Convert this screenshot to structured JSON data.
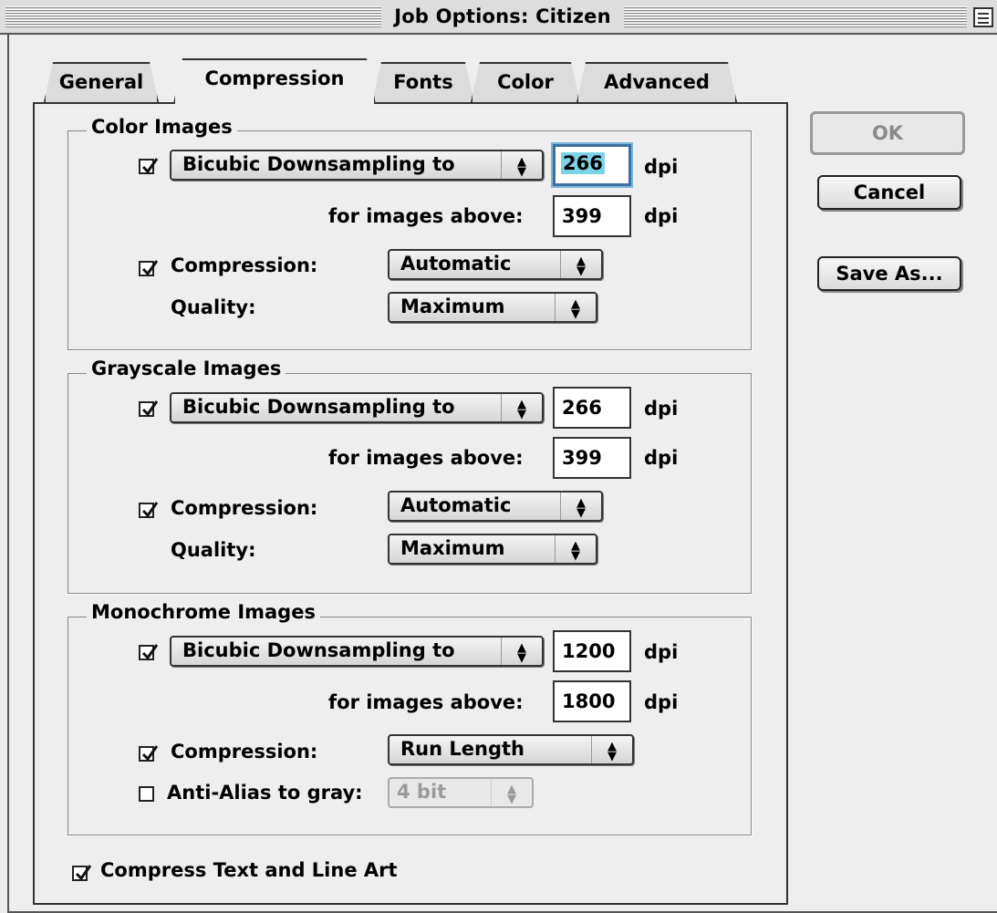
{
  "window": {
    "title": "Job Options: Citizen"
  },
  "tabs": [
    {
      "label": "General"
    },
    {
      "label": "Compression"
    },
    {
      "label": "Fonts"
    },
    {
      "label": "Color"
    },
    {
      "label": "Advanced"
    }
  ],
  "active_tab": "Compression",
  "buttons": {
    "ok": "OK",
    "cancel": "Cancel",
    "save_as": "Save As..."
  },
  "common": {
    "dpi_unit": "dpi",
    "above_label": "for images above:",
    "compression_label": "Compression:",
    "quality_label": "Quality:"
  },
  "color_images": {
    "title": "Color Images",
    "downsample_checked": true,
    "downsample_method": "Bicubic Downsampling to",
    "resolution": "266",
    "above": "399",
    "compression_checked": true,
    "compression": "Automatic",
    "quality": "Maximum"
  },
  "grayscale_images": {
    "title": "Grayscale Images",
    "downsample_checked": true,
    "downsample_method": "Bicubic Downsampling to",
    "resolution": "266",
    "above": "399",
    "compression_checked": true,
    "compression": "Automatic",
    "quality": "Maximum"
  },
  "monochrome_images": {
    "title": "Monochrome Images",
    "downsample_checked": true,
    "downsample_method": "Bicubic Downsampling to",
    "resolution": "1200",
    "above": "1800",
    "compression_checked": true,
    "compression": "Run Length",
    "antialias_checked": false,
    "antialias_label": "Anti-Alias to gray:",
    "antialias_value": "4 bit"
  },
  "compress_text": {
    "checked": true,
    "label": "Compress Text and Line Art"
  },
  "colors": {
    "focus_highlight": "#7cd3e6",
    "focus_ring": "#7fb5d8"
  }
}
